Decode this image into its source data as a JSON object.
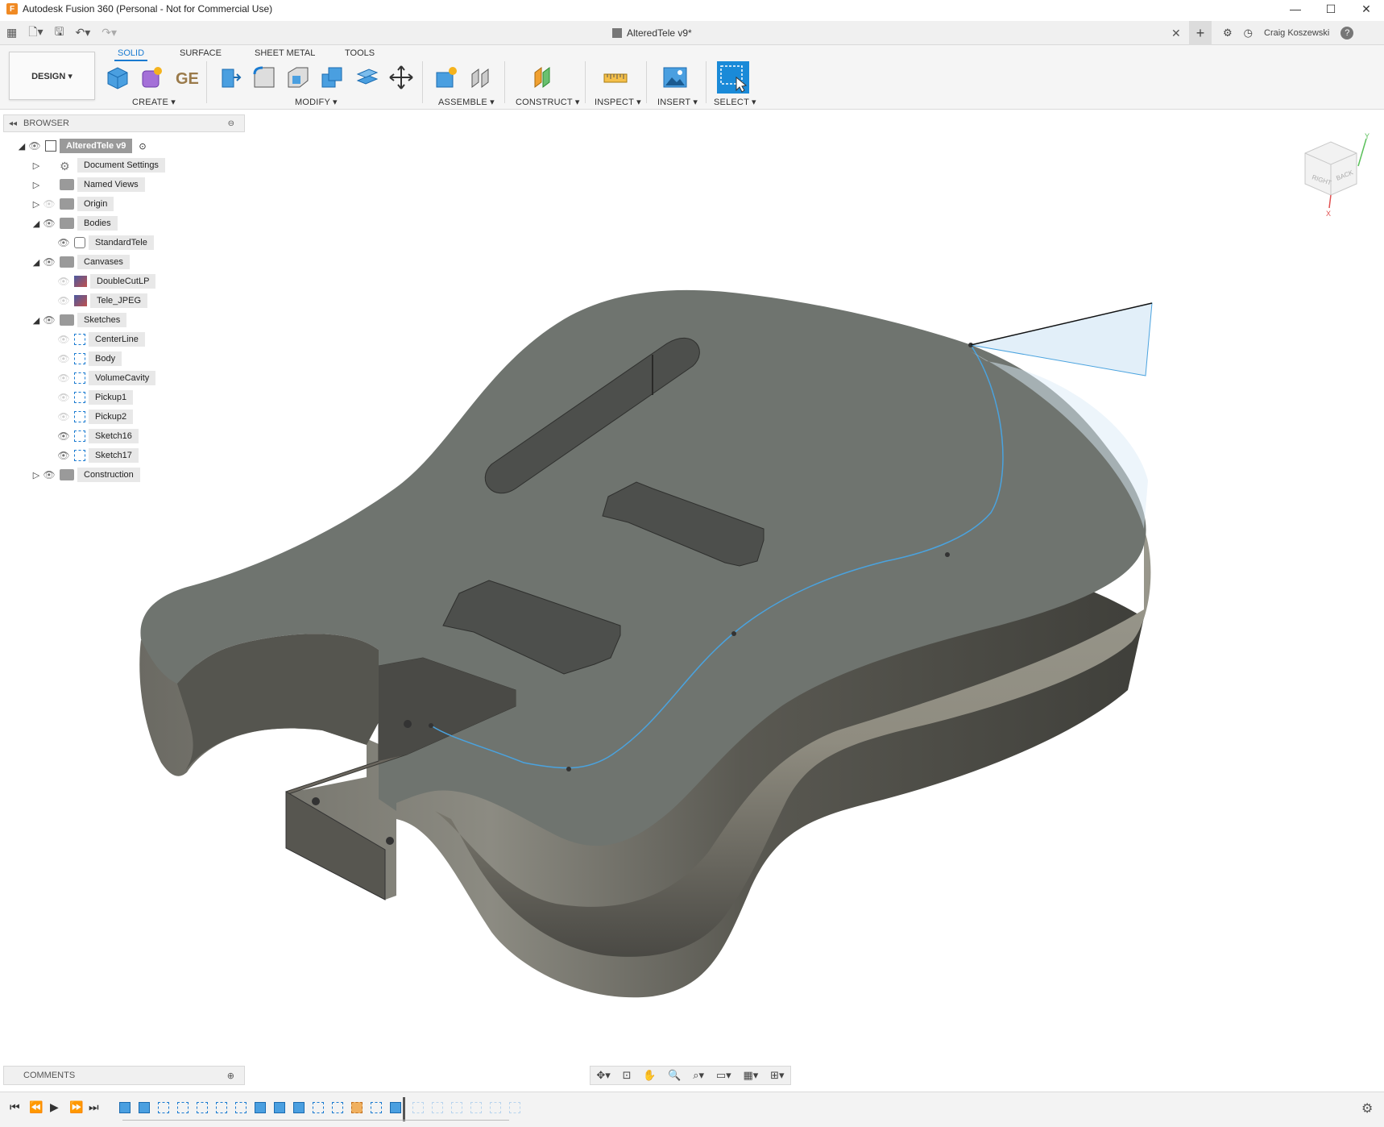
{
  "titlebar": {
    "title": "Autodesk Fusion 360 (Personal - Not for Commercial Use)",
    "logo_letter": "F",
    "minimize": "—",
    "maximize": "☐",
    "close": "✕"
  },
  "tabbar": {
    "doc_title": "AlteredTele v9*",
    "close": "✕",
    "new_tab": "+",
    "user": "Craig Koszewski",
    "help": "?"
  },
  "toolbar": {
    "workspace": "DESIGN ▾",
    "tabs": [
      "SOLID",
      "SURFACE",
      "SHEET METAL",
      "TOOLS"
    ],
    "active_tab": "SOLID",
    "groups": [
      "CREATE ▾",
      "MODIFY ▾",
      "ASSEMBLE ▾",
      "CONSTRUCT ▾",
      "INSPECT ▾",
      "INSERT ▾",
      "SELECT ▾"
    ],
    "accent": "#1a7bd1"
  },
  "browser": {
    "title": "BROWSER",
    "items": [
      {
        "label": "AlteredTele v9",
        "level": 0,
        "expanded": true,
        "visible": true,
        "icon": "component"
      },
      {
        "label": "Document Settings",
        "level": 1,
        "expanded": false,
        "visible": null,
        "icon": "gear"
      },
      {
        "label": "Named Views",
        "level": 1,
        "expanded": false,
        "visible": null,
        "icon": "folder"
      },
      {
        "label": "Origin",
        "level": 1,
        "expanded": false,
        "visible": false,
        "icon": "folder"
      },
      {
        "label": "Bodies",
        "level": 1,
        "expanded": true,
        "visible": true,
        "icon": "folder"
      },
      {
        "label": "StandardTele",
        "level": 2,
        "expanded": null,
        "visible": true,
        "icon": "body"
      },
      {
        "label": "Canvases",
        "level": 1,
        "expanded": true,
        "visible": true,
        "icon": "folder"
      },
      {
        "label": "DoubleCutLP",
        "level": 2,
        "expanded": null,
        "visible": false,
        "icon": "canvas"
      },
      {
        "label": "Tele_JPEG",
        "level": 2,
        "expanded": null,
        "visible": false,
        "icon": "canvas"
      },
      {
        "label": "Sketches",
        "level": 1,
        "expanded": true,
        "visible": true,
        "icon": "folder"
      },
      {
        "label": "CenterLine",
        "level": 2,
        "expanded": null,
        "visible": false,
        "icon": "sketch"
      },
      {
        "label": "Body",
        "level": 2,
        "expanded": null,
        "visible": false,
        "icon": "sketch"
      },
      {
        "label": "VolumeCavity",
        "level": 2,
        "expanded": null,
        "visible": false,
        "icon": "sketch"
      },
      {
        "label": "Pickup1",
        "level": 2,
        "expanded": null,
        "visible": false,
        "icon": "sketch"
      },
      {
        "label": "Pickup2",
        "level": 2,
        "expanded": null,
        "visible": false,
        "icon": "sketch"
      },
      {
        "label": "Sketch16",
        "level": 2,
        "expanded": null,
        "visible": true,
        "icon": "sketch"
      },
      {
        "label": "Sketch17",
        "level": 2,
        "expanded": null,
        "visible": true,
        "icon": "sketch"
      },
      {
        "label": "Construction",
        "level": 1,
        "expanded": false,
        "visible": true,
        "icon": "folder"
      }
    ]
  },
  "viewcube": {
    "face_right": "RIGHT",
    "face_back": "BACK",
    "axis_x": "X",
    "axis_y": "Y"
  },
  "comments": {
    "title": "COMMENTS"
  },
  "colors": {
    "body_top": "#6f746f",
    "body_side": "#55554f",
    "sketch_line": "#4aa3df"
  }
}
